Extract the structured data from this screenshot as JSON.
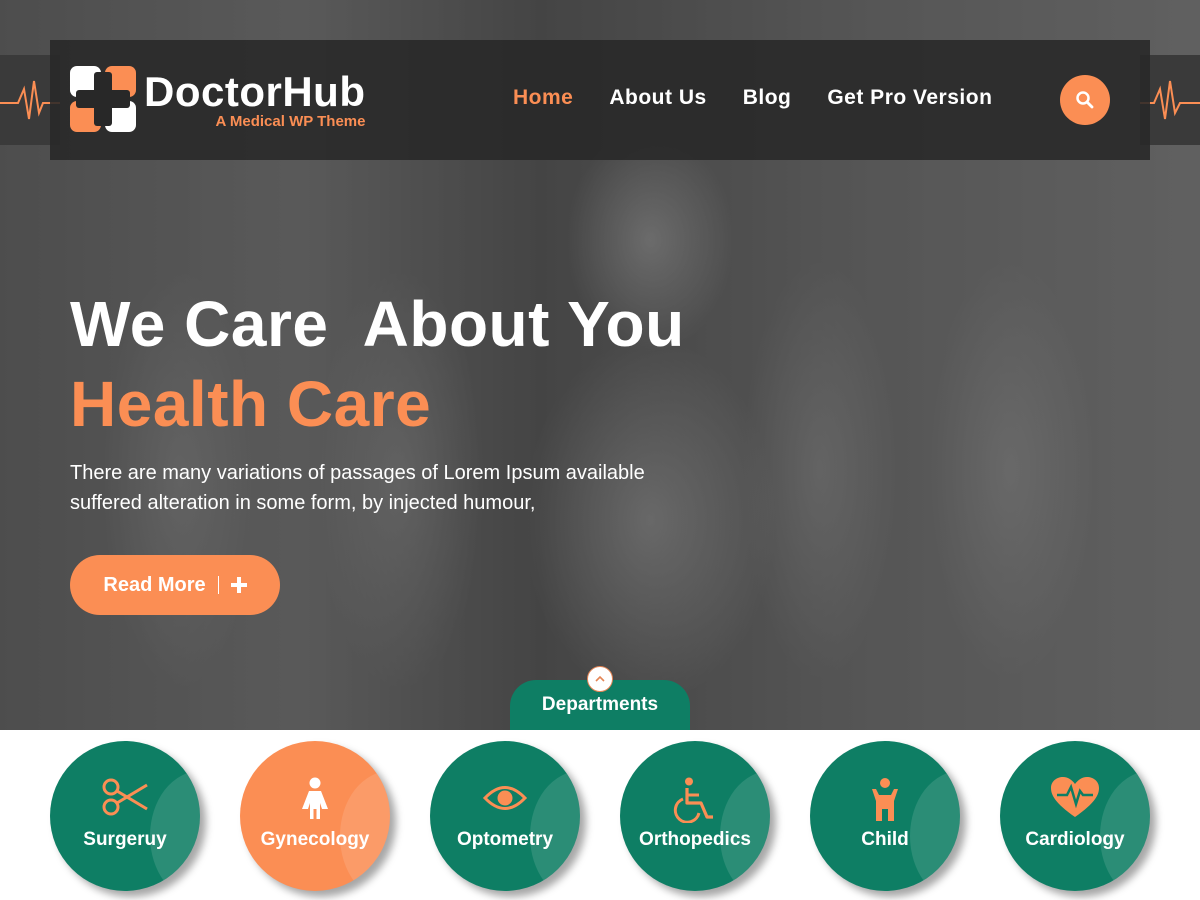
{
  "brand": {
    "name": "DoctorHub",
    "tagline": "A Medical WP Theme",
    "logo_icon": "medical-cross-icon"
  },
  "nav": {
    "items": [
      {
        "label": "Home",
        "active": true
      },
      {
        "label": "About Us",
        "active": false
      },
      {
        "label": "Blog",
        "active": false
      },
      {
        "label": "Get Pro Version",
        "active": false
      }
    ],
    "search_icon": "search-icon"
  },
  "hero": {
    "headline": "We Care  About You",
    "subheadline": "Health Care",
    "description_lines": [
      "There are many variations of passages of Lorem Ipsum available",
      "suffered alteration in some form, by injected humour,"
    ],
    "cta_label": "Read More",
    "cta_icon": "plus-icon"
  },
  "departments": {
    "tab_label": "Departments",
    "toggle_icon": "chevron-up-icon",
    "items": [
      {
        "label": "Surgeruy",
        "icon": "scissors-icon",
        "highlighted": false
      },
      {
        "label": "Gynecology",
        "icon": "woman-icon",
        "highlighted": true
      },
      {
        "label": "Optometry",
        "icon": "eye-icon",
        "highlighted": false
      },
      {
        "label": "Orthopedics",
        "icon": "wheelchair-icon",
        "highlighted": false
      },
      {
        "label": "Child",
        "icon": "child-icon",
        "highlighted": false
      },
      {
        "label": "Cardiology",
        "icon": "heart-pulse-icon",
        "highlighted": false
      }
    ]
  },
  "colors": {
    "accent_orange": "#fb8e54",
    "primary_green": "#0e7e64",
    "header_dark": "#282828",
    "white": "#ffffff"
  }
}
